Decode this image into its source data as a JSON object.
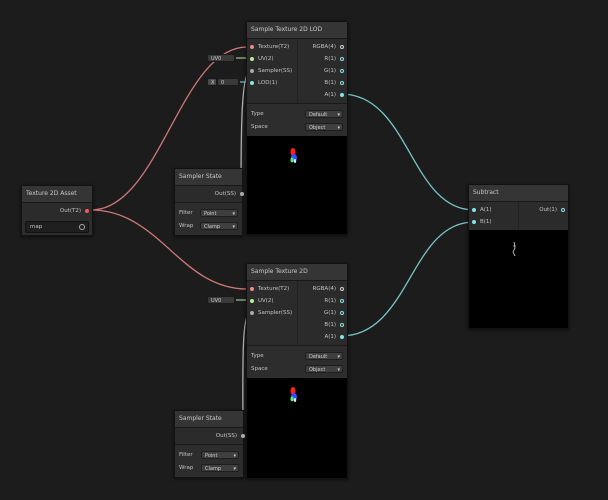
{
  "nodes": {
    "sample_lod": {
      "title": "Sample Texture 2D LOD",
      "inputs": [
        "Texture(T2)",
        "UV(2)",
        "Sampler(SS)",
        "LOD(1)"
      ],
      "outputs": [
        "RGBA(4)",
        "R(1)",
        "G(1)",
        "B(1)",
        "A(1)"
      ],
      "uv_value": "UV0",
      "lod_axis": "X",
      "lod_value": "0",
      "type_label": "Type",
      "type_value": "Default",
      "space_label": "Space",
      "space_value": "Object"
    },
    "sampler_1": {
      "title": "Sampler State",
      "output": "Out(SS)",
      "filter_label": "Filter",
      "filter_value": "Point",
      "wrap_label": "Wrap",
      "wrap_value": "Clamp"
    },
    "texture_asset": {
      "title": "Texture 2D Asset",
      "output": "Out(T2)",
      "field_value": "map"
    },
    "sample": {
      "title": "Sample Texture 2D",
      "inputs": [
        "Texture(T2)",
        "UV(2)",
        "Sampler(SS)"
      ],
      "outputs": [
        "RGBA(4)",
        "R(1)",
        "G(1)",
        "B(1)",
        "A(1)"
      ],
      "uv_value": "UV0",
      "type_label": "Type",
      "type_value": "Default",
      "space_label": "Space",
      "space_value": "Object"
    },
    "sampler_2": {
      "title": "Sampler State",
      "output": "Out(SS)",
      "filter_label": "Filter",
      "filter_value": "Point",
      "wrap_label": "Wrap",
      "wrap_value": "Clamp"
    },
    "subtract": {
      "title": "Subtract",
      "inputs": [
        "A(1)",
        "B(1)"
      ],
      "output": "Out(1)"
    }
  },
  "colors": {
    "background": "#1c1c1c",
    "texture_wire": "#d07878",
    "float_wire": "#78c6c8",
    "sampler_wire": "#b0b0b0",
    "uv_port": "#bfe89c"
  }
}
